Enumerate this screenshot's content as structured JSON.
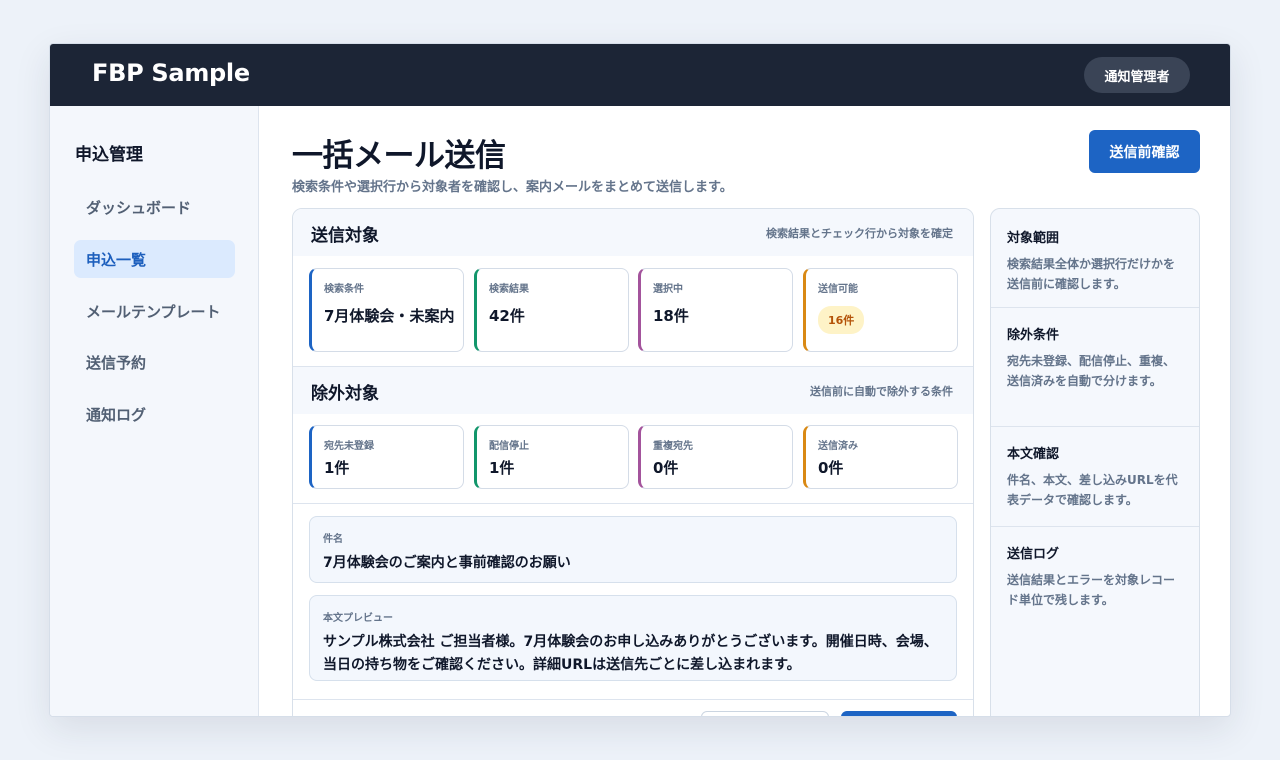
{
  "app": {
    "title": "FBP Sample",
    "user_badge": "通知管理者"
  },
  "sidebar": {
    "heading": "申込管理",
    "items": [
      {
        "label": "ダッシュボード",
        "active": false
      },
      {
        "label": "申込一覧",
        "active": true
      },
      {
        "label": "メールテンプレート",
        "active": false
      },
      {
        "label": "送信予約",
        "active": false
      },
      {
        "label": "通知ログ",
        "active": false
      }
    ]
  },
  "page": {
    "title": "一括メール送信",
    "subtitle": "検索条件や選択行から対象者を確認し、案内メールをまとめて送信します。",
    "confirm_button": "送信前確認"
  },
  "targets": {
    "title": "送信対象",
    "note": "検索結果とチェック行から対象を確定",
    "stats": [
      {
        "label": "検索条件",
        "value": "7月体験会・未案内"
      },
      {
        "label": "検索結果",
        "value": "42件"
      },
      {
        "label": "選択中",
        "value": "18件"
      },
      {
        "label": "送信可能",
        "value": "16件"
      }
    ]
  },
  "exclusions": {
    "title": "除外対象",
    "note": "送信前に自動で除外する条件",
    "stats": [
      {
        "label": "宛先未登録",
        "value": "1件"
      },
      {
        "label": "配信停止",
        "value": "1件"
      },
      {
        "label": "重複宛先",
        "value": "0件"
      },
      {
        "label": "送信済み",
        "value": "0件"
      }
    ]
  },
  "mail": {
    "subject_label": "件名",
    "subject": "7月体験会のご案内と事前確認のお願い",
    "body_label": "本文プレビュー",
    "body": "サンプル株式会社 ご担当者様。7月体験会のお申し込みありがとうございます。開催日時、会場、当日の持ち物をご確認ください。詳細URLは送信先ごとに差し込まれます。"
  },
  "info": [
    {
      "title": "対象範囲",
      "text": "検索結果全体か選択行だけかを送信前に確認します。"
    },
    {
      "title": "除外条件",
      "text": "宛先未登録、配信停止、重複、送信済みを自動で分けます。"
    },
    {
      "title": "本文確認",
      "text": "件名、本文、差し込みURLを代表データで確認します。"
    },
    {
      "title": "送信ログ",
      "text": "送信結果とエラーを対象レコード単位で残します。"
    }
  ],
  "colors": {
    "topbar": "#1c2536",
    "primary": "#1d64c4",
    "accent_blue": "#1d64c4",
    "accent_green": "#12966b",
    "accent_purple": "#a3539c",
    "accent_orange": "#d98914",
    "pill_bg": "#fef3c7",
    "pill_text": "#b45309"
  }
}
